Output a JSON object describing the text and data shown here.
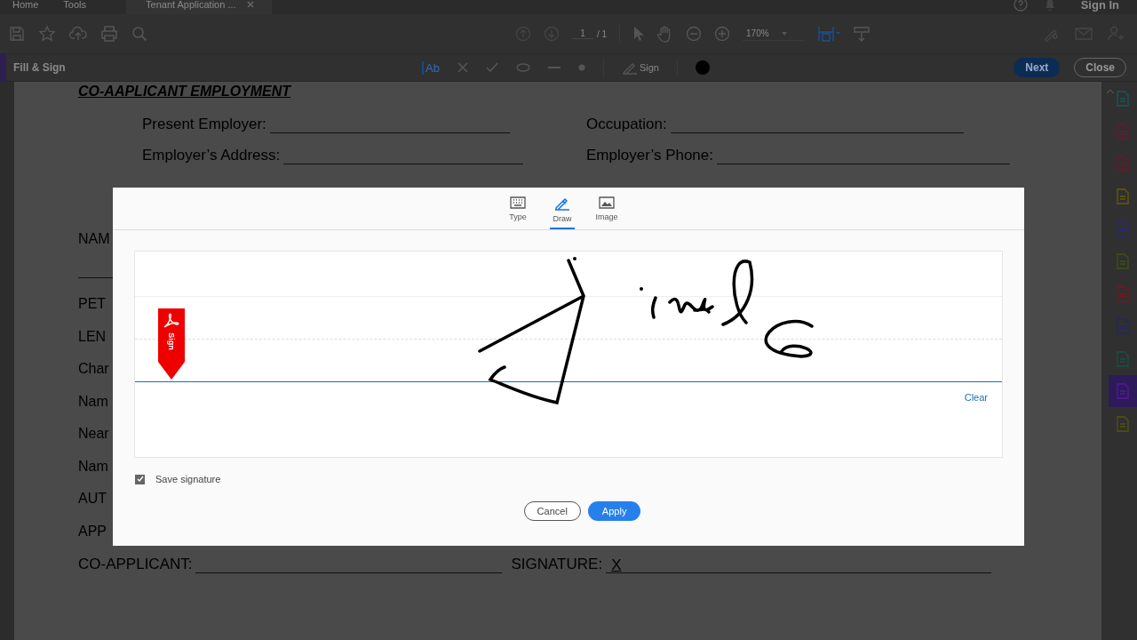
{
  "app_tabs": [
    {
      "label": "Home",
      "selected": false
    },
    {
      "label": "Tools",
      "selected": false
    },
    {
      "label": "Tenant Application ...",
      "selected": true
    }
  ],
  "account": {
    "sign_in": "Sign In"
  },
  "toolbar": {
    "page_current": "1",
    "page_total": "/ 1",
    "zoom": "170%"
  },
  "fill_sign": {
    "title": "Fill & Sign",
    "text_tool": "Ab",
    "sign_label": "Sign",
    "next": "Next",
    "close": "Close"
  },
  "side_tools": [
    {
      "color": "#1f4d52",
      "selected": false
    },
    {
      "color": "#5a1f33",
      "selected": false
    },
    {
      "color": "#5a1f2a",
      "selected": false
    },
    {
      "color": "#5a4f10",
      "selected": false
    },
    {
      "color": "#2a2a6a",
      "selected": false
    },
    {
      "color": "#3a4a18",
      "selected": false
    },
    {
      "color": "#6a1a22",
      "selected": false
    },
    {
      "color": "#26285a",
      "selected": false
    },
    {
      "color": "#1a4a40",
      "selected": false
    },
    {
      "color": "#4a1a88",
      "selected": true
    },
    {
      "color": "#4a4a18",
      "selected": false
    }
  ],
  "document": {
    "heading": "CO-AAPLICANT EMPLOYMENT",
    "field_rows": [
      [
        "Present Employer:",
        "Occupation:"
      ],
      [
        "Employer’s Address:",
        "Employer’s Phone:"
      ]
    ],
    "left_labels": [
      "NAM",
      "PET",
      "LEN",
      "Char",
      "Nam",
      "Near",
      "Nam",
      "AUT",
      "APP"
    ],
    "co_applicant": "CO-APPLICANT:",
    "signature": "SIGNATURE:",
    "signature_mark": "X"
  },
  "dialog": {
    "tabs": [
      {
        "label": "Type",
        "selected": false
      },
      {
        "label": "Draw",
        "selected": true
      },
      {
        "label": "Image",
        "selected": false
      }
    ],
    "sign_flag": "Sign",
    "clear": "Clear",
    "save_signature": {
      "label": "Save signature",
      "checked": true
    },
    "cancel": "Cancel",
    "apply": "Apply"
  }
}
